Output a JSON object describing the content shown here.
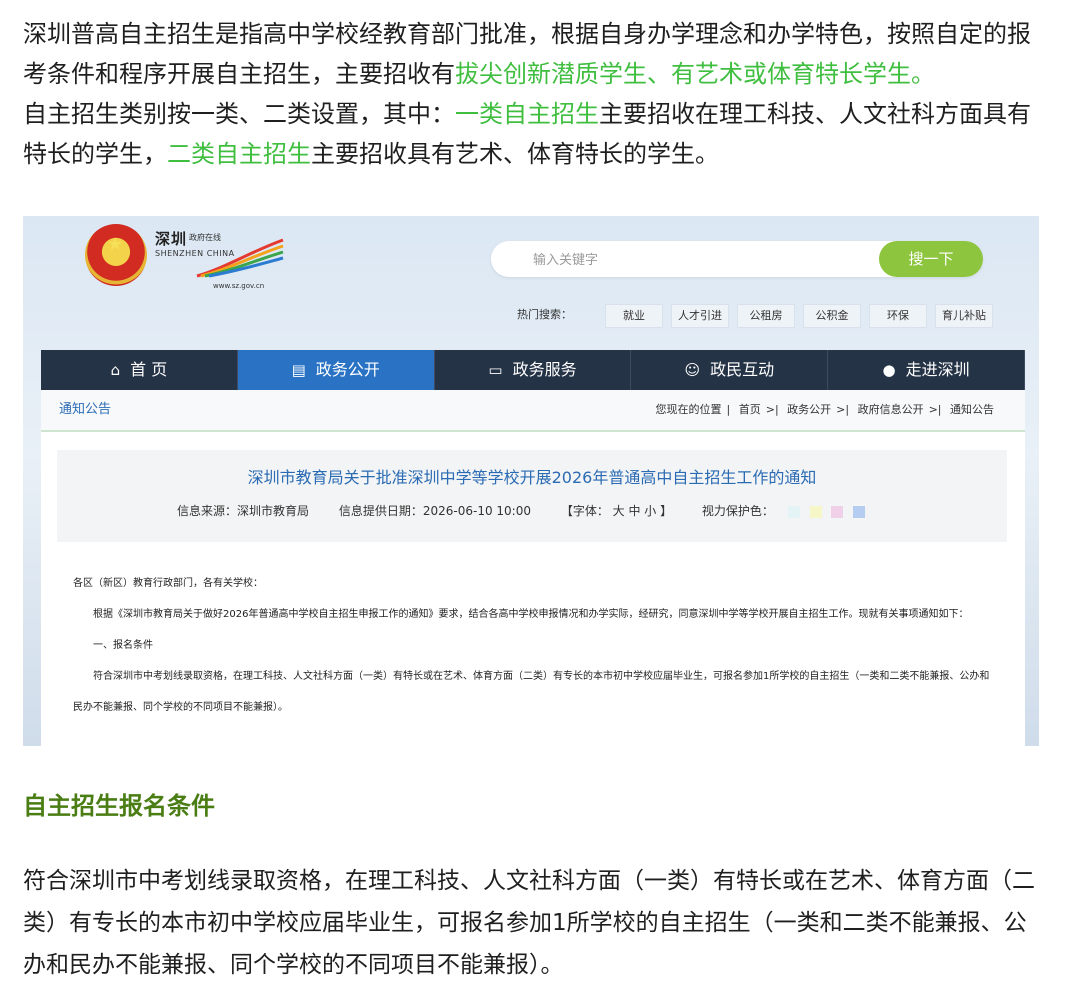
{
  "intro": {
    "p1_a": "深圳普高自主招生是指高中学校经教育部门批准，根据自身办学理念和办学特色，按照自定的报考条件和程序开展自主招生，主要招收有",
    "p1_hl": "拔尖创新潜质学生、有艺术或体育特长学生。",
    "p2_a": "自主招生类别按一类、二类设置，其中：",
    "p2_hl1": "一类自主招生",
    "p2_b": "主要招收在理工科技、人文社科方面具有特长的学生，",
    "p2_hl2": "二类自主招生",
    "p2_c": "主要招收具有艺术、体育特长的学生。",
    "highlight_color": "#3fbe3f"
  },
  "screenshot": {
    "logo": {
      "cn": "深圳",
      "small": "政府在线",
      "en": "SHENZHEN CHINA",
      "url": "www.sz.gov.cn"
    },
    "search": {
      "placeholder": "输入关键字",
      "button": "搜一下"
    },
    "hot": {
      "label": "热门搜索：",
      "tags": [
        "就业",
        "人才引进",
        "公租房",
        "公积金",
        "环保",
        "育儿补贴"
      ]
    },
    "nav": [
      {
        "label": "首 页",
        "icon": "home-icon"
      },
      {
        "label": "政务公开",
        "icon": "news-icon"
      },
      {
        "label": "政务服务",
        "icon": "monitor-icon"
      },
      {
        "label": "政民互动",
        "icon": "people-icon"
      },
      {
        "label": "走进深圳",
        "icon": "info-icon"
      }
    ],
    "breadcrumb": {
      "section": "通知公告",
      "location": "您现在的位置",
      "items": [
        "首页",
        "政务公开",
        "政府信息公开",
        "通知公告"
      ]
    },
    "article": {
      "title": "深圳市教育局关于批准深圳中学等学校开展2026年普通高中自主招生工作的通知",
      "source": "信息来源：深圳市教育局",
      "date": "信息提供日期：2026-06-10 10:00",
      "font": "【字体：  大  中  小  】",
      "eye": "视力保护色：",
      "swatches": [
        "#e3f3f6",
        "#f6f6c8",
        "#f0cfe9",
        "#b5cdf0"
      ],
      "body": [
        "各区（新区）教育行政部门，各有关学校：",
        "根据《深圳市教育局关于做好2026年普通高中学校自主招生申报工作的通知》要求，结合各高中学校申报情况和办学实际，经研究，同意深圳中学等学校开展自主招生工作。现就有关事项通知如下：",
        "一、报名条件",
        "符合深圳市中考划线录取资格，在理工科技、人文社科方面（一类）有特长或在艺术、体育方面（二类）有专长的本市初中学校应届毕业生，可报名参加1所学校的自主招生（一类和二类不能兼报、公办和民办不能兼报、同个学校的不同项目不能兼报）。"
      ]
    }
  },
  "section": {
    "title": "自主招生报名条件",
    "title_color": "#4a7d14",
    "text": "符合深圳市中考划线录取资格，在理工科技、人文社科方面（一类）有特长或在艺术、体育方面（二类）有专长的本市初中学校应届毕业生，可报名参加1所学校的自主招生（一类和二类不能兼报、公办和民办不能兼报、同个学校的不同项目不能兼报）。"
  }
}
